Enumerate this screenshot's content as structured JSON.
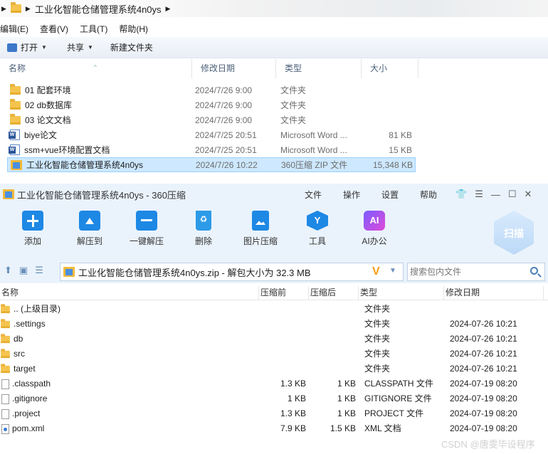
{
  "explorer": {
    "address": {
      "path": "工业化智能仓储管理系统4n0ys"
    },
    "menu": [
      "编辑(E)",
      "查看(V)",
      "工具(T)",
      "帮助(H)"
    ],
    "commands": {
      "open": "打开",
      "share": "共享",
      "new_folder": "新建文件夹"
    },
    "columns": {
      "name": "名称",
      "modified": "修改日期",
      "type": "类型",
      "size": "大小"
    },
    "rows": [
      {
        "icon": "folder-icon",
        "name": "01 配套环境",
        "modified": "2024/7/26 9:00",
        "type": "文件夹",
        "size": ""
      },
      {
        "icon": "folder-icon",
        "name": "02 db数据库",
        "modified": "2024/7/26 9:00",
        "type": "文件夹",
        "size": ""
      },
      {
        "icon": "folder-icon",
        "name": "03 论文文档",
        "modified": "2024/7/26 9:00",
        "type": "文件夹",
        "size": ""
      },
      {
        "icon": "word-doc-icon",
        "name": "biye论文",
        "modified": "2024/7/25 20:51",
        "type": "Microsoft Word ...",
        "size": "81 KB"
      },
      {
        "icon": "word-doc-icon",
        "name": "ssm+vue环境配置文档",
        "modified": "2024/7/25 20:51",
        "type": "Microsoft Word ...",
        "size": "15 KB"
      },
      {
        "icon": "zip-icon",
        "name": "工业化智能仓储管理系统4n0ys",
        "modified": "2024/7/26 10:22",
        "type": "360压缩 ZIP 文件",
        "size": "15,348 KB",
        "selected": true
      }
    ]
  },
  "zip360": {
    "title": "工业化智能仓储管理系统4n0ys - 360压缩",
    "title_menu": [
      "文件",
      "操作",
      "设置",
      "帮助"
    ],
    "window_controls": {
      "skin": "shirt-icon",
      "feedback": "message-icon",
      "minimize": "—",
      "maximize": "☐",
      "close": "✕"
    },
    "toolbar": [
      {
        "label": "添加",
        "icon": "add-icon"
      },
      {
        "label": "解压到",
        "icon": "extract-icon"
      },
      {
        "label": "一键解压",
        "icon": "one-click-extract-icon"
      },
      {
        "label": "删除",
        "icon": "delete-icon"
      },
      {
        "label": "图片压缩",
        "icon": "image-compress-icon"
      },
      {
        "label": "工具",
        "icon": "tools-icon"
      },
      {
        "label": "AI办公",
        "icon": "ai-office-icon"
      }
    ],
    "scan_label": "扫描",
    "path": "工业化智能仓储管理系统4n0ys.zip - 解包大小为 32.3 MB",
    "search_placeholder": "搜索包内文件",
    "columns": {
      "name": "名称",
      "compressed": "压缩前",
      "packed": "压缩后",
      "type": "类型",
      "modified": "修改日期"
    },
    "rows": [
      {
        "icon": "folder-icon",
        "name": ".. (上级目录)",
        "before": "",
        "after": "",
        "type": "文件夹",
        "modified": ""
      },
      {
        "icon": "folder-icon",
        "name": ".settings",
        "before": "",
        "after": "",
        "type": "文件夹",
        "modified": "2024-07-26 10:21"
      },
      {
        "icon": "folder-icon",
        "name": "db",
        "before": "",
        "after": "",
        "type": "文件夹",
        "modified": "2024-07-26 10:21"
      },
      {
        "icon": "folder-icon",
        "name": "src",
        "before": "",
        "after": "",
        "type": "文件夹",
        "modified": "2024-07-26 10:21"
      },
      {
        "icon": "folder-icon",
        "name": "target",
        "before": "",
        "after": "",
        "type": "文件夹",
        "modified": "2024-07-26 10:21"
      },
      {
        "icon": "file-icon",
        "name": ".classpath",
        "before": "1.3 KB",
        "after": "1 KB",
        "type": "CLASSPATH 文件",
        "modified": "2024-07-19 08:20"
      },
      {
        "icon": "file-icon",
        "name": ".gitignore",
        "before": "1 KB",
        "after": "1 KB",
        "type": "GITIGNORE 文件",
        "modified": "2024-07-19 08:20"
      },
      {
        "icon": "file-icon",
        "name": ".project",
        "before": "1.3 KB",
        "after": "1 KB",
        "type": "PROJECT 文件",
        "modified": "2024-07-19 08:20"
      },
      {
        "icon": "xml-icon",
        "name": "pom.xml",
        "before": "7.9 KB",
        "after": "1.5 KB",
        "type": "XML 文档",
        "modified": "2024-07-19 08:20"
      }
    ]
  },
  "watermark": "CSDN @唐雯毕设程序"
}
